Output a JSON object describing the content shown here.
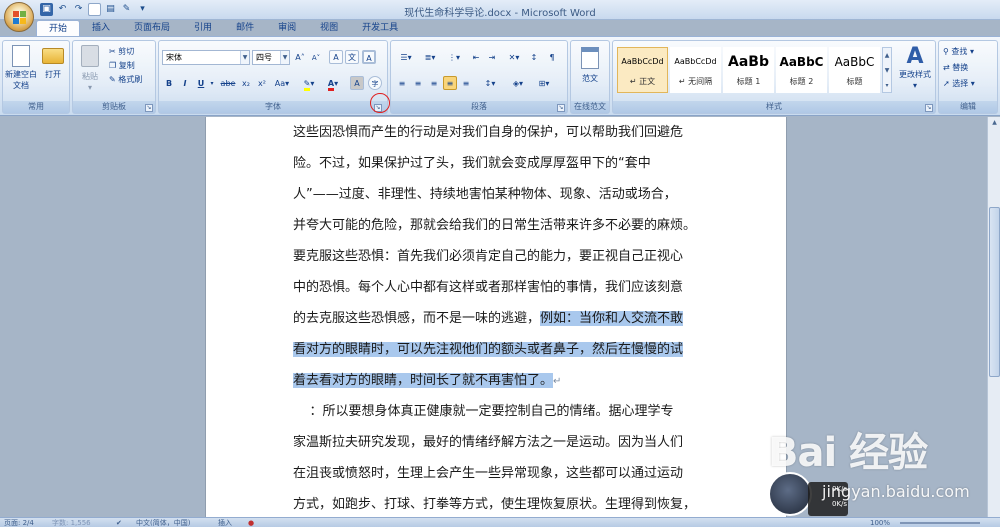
{
  "window": {
    "title": "现代生命科学导论.docx - Microsoft Word"
  },
  "quick_access": [
    "save-icon",
    "undo-icon",
    "redo-icon",
    "new-doc-icon",
    "print-preview-icon",
    "format-painter-icon"
  ],
  "tabs": [
    {
      "label": "开始",
      "active": true
    },
    {
      "label": "插入"
    },
    {
      "label": "页面布局"
    },
    {
      "label": "引用"
    },
    {
      "label": "邮件"
    },
    {
      "label": "审阅"
    },
    {
      "label": "视图"
    },
    {
      "label": "开发工具"
    }
  ],
  "ribbon": {
    "common": {
      "label": "常用",
      "new_blank": "新建空白文档",
      "open": "打开"
    },
    "clipboard": {
      "label": "剪贴板",
      "paste": "粘贴",
      "cut": "剪切",
      "copy": "复制",
      "format_painter": "格式刷"
    },
    "font": {
      "label": "字体",
      "font_name": "宋体",
      "font_size": "四号",
      "bold": "B",
      "italic": "I",
      "underline": "U",
      "strike": "abe",
      "subscript": "x₂",
      "superscript": "x²",
      "change_case": "Aa",
      "font_color": "A",
      "char_shading": "A",
      "grow": "A",
      "shrink": "A",
      "clear": "A",
      "phonetic": "文",
      "char_border": "A",
      "enclose": "字"
    },
    "paragraph": {
      "label": "段落"
    },
    "online": {
      "label": "在线范文",
      "button": "范文"
    },
    "styles": {
      "label": "样式",
      "items": [
        {
          "sample": "AaBbCcDd",
          "name": "↵ 正文",
          "selected": true
        },
        {
          "sample": "AaBbCcDd",
          "name": "↵ 无间隔",
          "selected": false
        },
        {
          "sample": "AaBb",
          "name": "标题 1",
          "selected": false
        },
        {
          "sample": "AaBbC",
          "name": "标题 2",
          "selected": false
        },
        {
          "sample": "AaBbC",
          "name": "标题",
          "selected": false
        }
      ],
      "change_styles": "更改样式"
    },
    "editing": {
      "label": "编辑",
      "find": "查找",
      "replace": "替换",
      "select": "选择"
    }
  },
  "document": {
    "lines": [
      {
        "pre": "这些因恐惧而产生的行动是对我们自身的保护，可以帮助我们回避危",
        "hl": "",
        "post": ""
      },
      {
        "pre": "险。不过，如果保护过了头，我们就会变成厚厚盔甲下的“套中",
        "hl": "",
        "post": ""
      },
      {
        "pre": "人”——过度、非理性、持续地害怕某种物体、现象、活动或场合，",
        "hl": "",
        "post": ""
      },
      {
        "pre": "并夸大可能的危险，那就会给我们的日常生活带来许多不必要的麻烦。",
        "hl": "",
        "post": ""
      },
      {
        "pre": "要克服这些恐惧：首先我们必须肯定自己的能力，要正视自己正视心",
        "hl": "",
        "post": ""
      },
      {
        "pre": "中的恐惧。每个人心中都有这样或者那样害怕的事情，我们应该刻意",
        "hl": "",
        "post": ""
      },
      {
        "pre": "的去克服这些恐惧感，而不是一味的逃避，",
        "hl": "例如：当你和人交流不敢",
        "post": ""
      },
      {
        "pre": "",
        "hl": "看对方的眼睛时，可以先注视他们的额头或者鼻子，然后在慢慢的试",
        "post": ""
      },
      {
        "pre": "",
        "hl": "着去看对方的眼睛，时间长了就不再害怕了。",
        "post": "↵"
      },
      {
        "pre": "    ：所以要想身体真正健康就一定要控制自己的情绪。据心理学专",
        "hl": "",
        "post": ""
      },
      {
        "pre": "家温斯拉夫研究发现，最好的情绪纾解方法之一是运动。因为当人们",
        "hl": "",
        "post": ""
      },
      {
        "pre": "在沮丧或愤怒时，生理上会产生一些异常现象，这些都可以通过运动",
        "hl": "",
        "post": ""
      },
      {
        "pre": "方式，如跑步、打球、打拳等方式，使生理恢复原状。生理得到恢复，",
        "hl": "",
        "post": ""
      }
    ]
  },
  "status": {
    "page": "页面: 2/4",
    "words": "字数: 1,556",
    "lang": "中文(简体，中国)",
    "mode": "插入",
    "zoom": "100%"
  },
  "watermark": {
    "logo": "Bai 经验",
    "url": "jingyan.baidu.com",
    "net1": "0K/s",
    "net2": "0K/s"
  }
}
